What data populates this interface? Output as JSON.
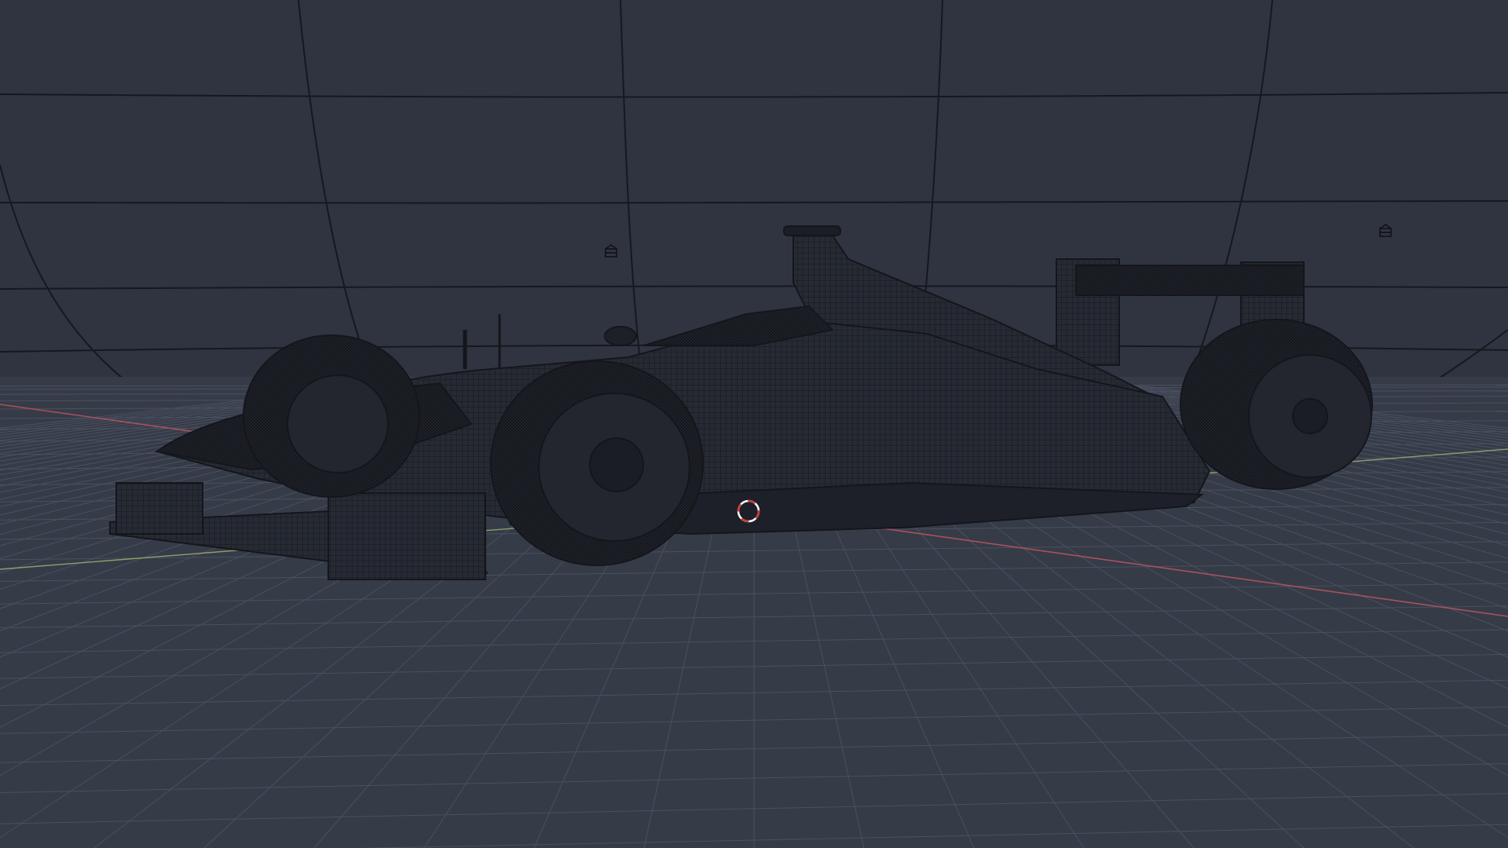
{
  "app": {
    "name": "3D viewport",
    "mode": "wireframe"
  },
  "viewport": {
    "background_color": "#2e333f",
    "floor_color": "#3a4050",
    "grid_line_color": "#4a5060",
    "backdrop_line_color": "#15181e",
    "x_axis_color": "#a8525c",
    "y_axis_color": "#8aa06a",
    "wire_color": "#1a1d24",
    "wire_fill_color": "#22262f"
  },
  "scene": {
    "object": "formula-car",
    "objects": [
      {
        "name": "formula-car",
        "type": "mesh"
      },
      {
        "name": "backdrop-cyclorama",
        "type": "mesh"
      },
      {
        "name": "light-left",
        "type": "light",
        "icon": "light-icon"
      },
      {
        "name": "light-right",
        "type": "light",
        "icon": "light-icon"
      }
    ]
  },
  "cursor_3d": {
    "icon": "3d-cursor-icon",
    "colors": [
      "#ffffff",
      "#d23a3a"
    ]
  }
}
